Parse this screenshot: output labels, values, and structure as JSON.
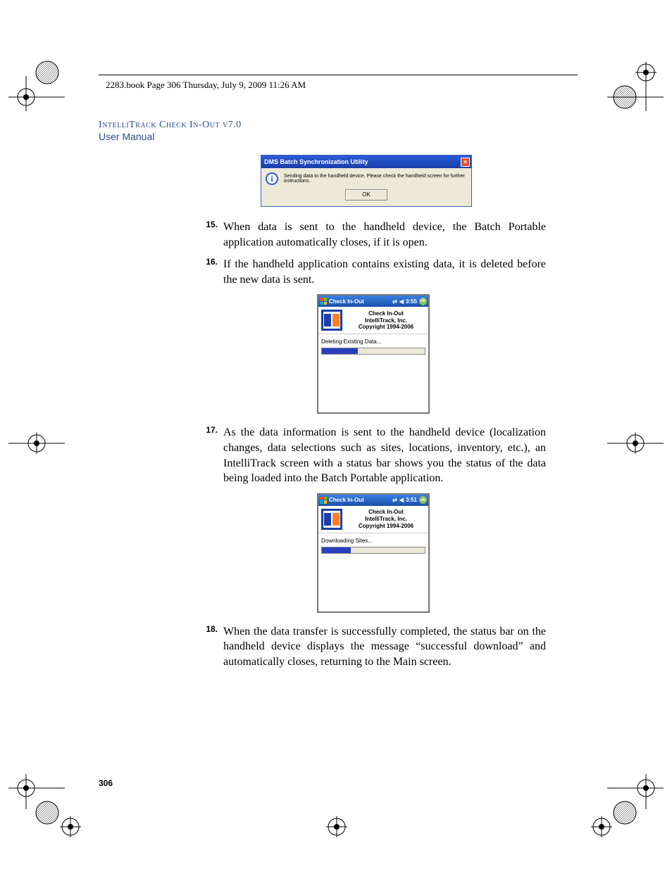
{
  "header": {
    "running": "2283.book  Page 306  Thursday, July 9, 2009  11:26 AM"
  },
  "title": {
    "main": "IntelliTrack Check In-Out v7.0",
    "sub": "User Manual"
  },
  "dialog": {
    "title": "DMS Batch Synchronization Utility",
    "message": "Sending data to the handheld device. Please check the handheld screen for further instructions.",
    "ok": "OK"
  },
  "steps": {
    "n15": "15.",
    "t15": "When data is sent to the handheld device, the Batch Portable application automatically closes, if it is open.",
    "n16": "16.",
    "t16": "If the handheld application contains existing data, it is deleted before the new data is sent.",
    "n17": "17.",
    "t17": "As the data information is sent to the handheld device (localization changes, data selections such as sites, locations, inventory, etc.), an IntelliTrack screen with a status bar shows you the status of the data being loaded into the Batch Portable application.",
    "n18": "18.",
    "t18": "When the data transfer is successfully completed, the status bar on the handheld device displays the message “successful download” and automatically closes, returning to the Main screen."
  },
  "handheld": {
    "title": "Check In-Out",
    "time1": "3:55",
    "time2": "3:51",
    "ok": "ok",
    "banner_line1": "Check In-Out",
    "banner_line2": "IntelliTrack, Inc.",
    "banner_line3": "Copyright 1994-2006",
    "status1": "Deleting Existing Data...",
    "status2": "Downloading Sites..."
  },
  "footer": {
    "page": "306"
  },
  "icons": {
    "conn": "⇄",
    "vol": "◀"
  }
}
